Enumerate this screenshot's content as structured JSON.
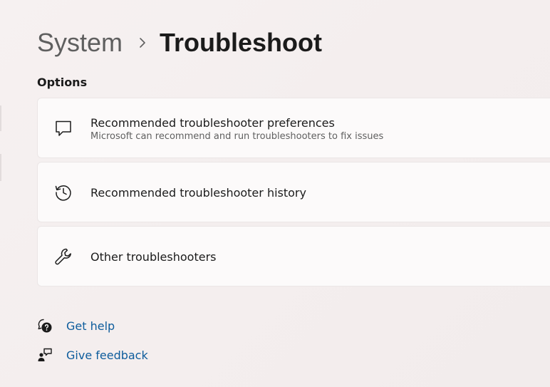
{
  "breadcrumb": {
    "parent": "System",
    "current": "Troubleshoot"
  },
  "options": {
    "title": "Options",
    "items": [
      {
        "icon": "message-bubble-icon",
        "title": "Recommended troubleshooter preferences",
        "description": "Microsoft can recommend and run troubleshooters to fix issues"
      },
      {
        "icon": "history-icon",
        "title": "Recommended troubleshooter history"
      },
      {
        "icon": "wrench-icon",
        "title": "Other troubleshooters"
      }
    ]
  },
  "links": {
    "get_help": "Get help",
    "give_feedback": "Give feedback"
  },
  "colors": {
    "link": "#0d5c9c",
    "card_background": "#fcfafa"
  }
}
